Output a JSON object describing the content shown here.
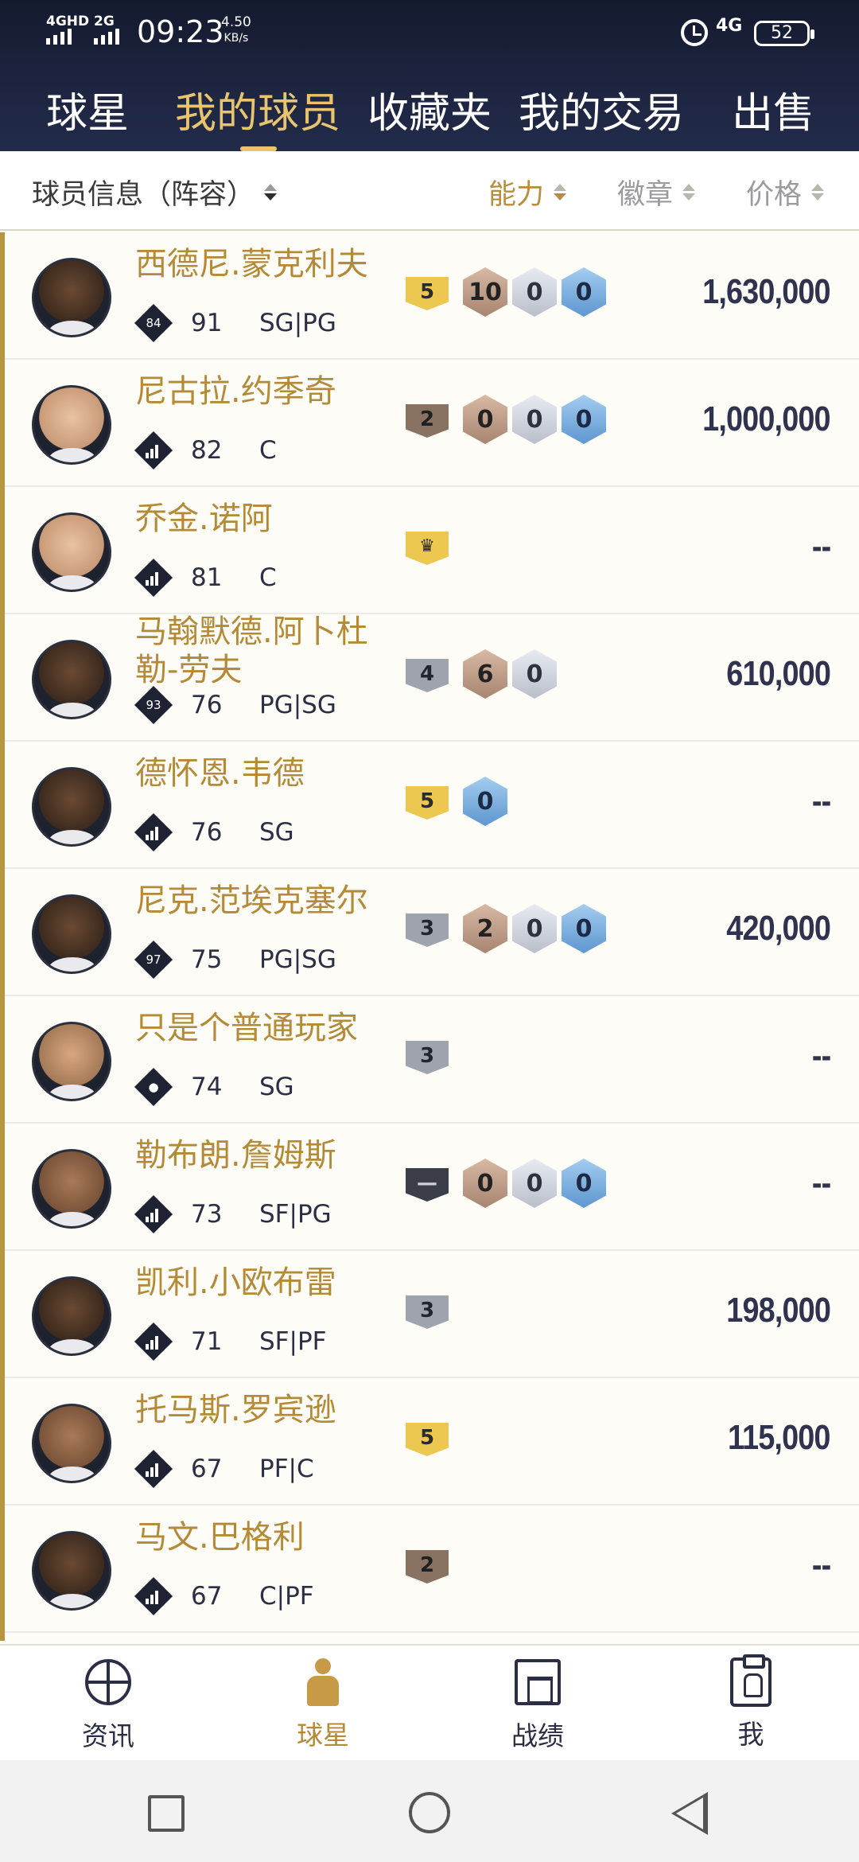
{
  "status_bar": {
    "network_1": "4GHD",
    "network_2": "2G",
    "time": "09:23",
    "speed_value": "4.50",
    "speed_unit": "KB/s",
    "network_right": "4G",
    "battery": "52"
  },
  "tabs": [
    {
      "label": "球星",
      "active": false
    },
    {
      "label": "我的球员",
      "active": true
    },
    {
      "label": "收藏夹",
      "active": false
    },
    {
      "label": "我的交易",
      "active": false
    },
    {
      "label": "出售",
      "active": false
    }
  ],
  "sort_bar": {
    "player_info": "球员信息（阵容）",
    "ability": "能力",
    "badge": "徽章",
    "price": "价格"
  },
  "players": [
    {
      "name": "西德尼.蒙克利夫",
      "rank_icon": "number",
      "rank_num": "84",
      "ovr": "91",
      "pos": "SG|PG",
      "tier": "5",
      "tier_color": "gold",
      "badges": [
        "10",
        "0",
        "0"
      ],
      "price": "1,630,000"
    },
    {
      "name": "尼古拉.约季奇",
      "rank_icon": "bars",
      "rank_num": "",
      "ovr": "82",
      "pos": "C",
      "tier": "2",
      "tier_color": "bronze",
      "badges": [
        "0",
        "0",
        "0"
      ],
      "price": "1,000,000"
    },
    {
      "name": "乔金.诺阿",
      "rank_icon": "bars",
      "rank_num": "",
      "ovr": "81",
      "pos": "C",
      "tier": "crown",
      "tier_color": "crown",
      "badges": [],
      "price": "--"
    },
    {
      "name": "马翰默德.阿卜杜勒-劳夫",
      "rank_icon": "number",
      "rank_num": "93",
      "ovr": "76",
      "pos": "PG|SG",
      "tier": "4",
      "tier_color": "silver",
      "badges": [
        "6",
        "0"
      ],
      "price": "610,000"
    },
    {
      "name": "德怀恩.韦德",
      "rank_icon": "bars",
      "rank_num": "",
      "ovr": "76",
      "pos": "SG",
      "tier": "5",
      "tier_color": "gold",
      "badges": [
        "0"
      ],
      "price": "--"
    },
    {
      "name": "尼克.范埃克塞尔",
      "rank_icon": "number",
      "rank_num": "97",
      "ovr": "75",
      "pos": "PG|SG",
      "tier": "3",
      "tier_color": "silver",
      "badges": [
        "2",
        "0",
        "0"
      ],
      "price": "420,000"
    },
    {
      "name": "只是个普通玩家",
      "rank_icon": "person",
      "rank_num": "",
      "ovr": "74",
      "pos": "SG",
      "tier": "3",
      "tier_color": "silver",
      "badges": [],
      "price": "--"
    },
    {
      "name": "勒布朗.詹姆斯",
      "rank_icon": "bars",
      "rank_num": "",
      "ovr": "73",
      "pos": "SF|PG",
      "tier": "—",
      "tier_color": "dark",
      "badges": [
        "0",
        "0",
        "0"
      ],
      "price": "--"
    },
    {
      "name": "凯利.小欧布雷",
      "rank_icon": "bars",
      "rank_num": "",
      "ovr": "71",
      "pos": "SF|PF",
      "tier": "3",
      "tier_color": "silver",
      "badges": [],
      "price": "198,000"
    },
    {
      "name": "托马斯.罗宾逊",
      "rank_icon": "bars",
      "rank_num": "",
      "ovr": "67",
      "pos": "PF|C",
      "tier": "5",
      "tier_color": "gold",
      "badges": [],
      "price": "115,000"
    },
    {
      "name": "马文.巴格利",
      "rank_icon": "bars",
      "rank_num": "",
      "ovr": "67",
      "pos": "C|PF",
      "tier": "2",
      "tier_color": "bronze",
      "badges": [],
      "price": "--"
    }
  ],
  "bottom_nav": [
    {
      "label": "资讯",
      "icon": "basketball-icon",
      "active": false
    },
    {
      "label": "球星",
      "icon": "player-icon",
      "active": true
    },
    {
      "label": "战绩",
      "icon": "hoop-icon",
      "active": false
    },
    {
      "label": "我",
      "icon": "profile-icon",
      "active": false
    }
  ],
  "system_nav": [
    "recent-apps-icon",
    "home-icon",
    "back-icon"
  ]
}
